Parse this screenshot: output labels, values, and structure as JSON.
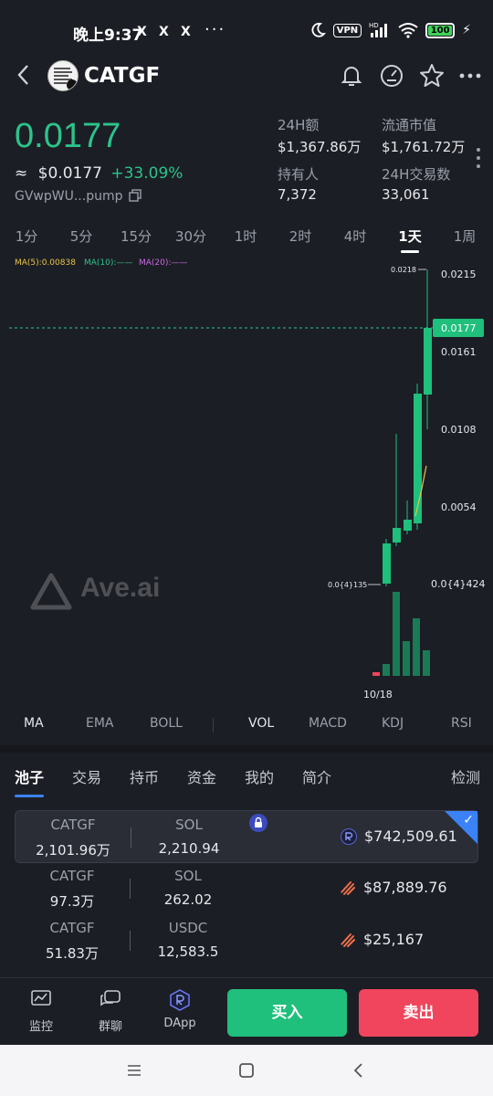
{
  "status": {
    "time": "晚上9:37",
    "x_icons": [
      "X",
      "X",
      "X"
    ],
    "more": "···",
    "vpn": "VPN",
    "hd": "HD",
    "battery": "100"
  },
  "header": {
    "symbol": "CATGF"
  },
  "price": {
    "main": "0.0177",
    "approx": "≈",
    "usd": "$0.0177",
    "change": "+33.09%",
    "address": "GVwpWU...pump"
  },
  "stats": [
    {
      "label": "24H额",
      "value": "$1,367.86万"
    },
    {
      "label": "流通市值",
      "value": "$1,761.72万"
    },
    {
      "label": "持有人",
      "value": "7,372"
    },
    {
      "label": "24H交易数",
      "value": "33,061"
    }
  ],
  "intervals": [
    "1分",
    "5分",
    "15分",
    "30分",
    "1时",
    "2时",
    "4时",
    "1天",
    "1周"
  ],
  "active_interval": "1天",
  "chart": {
    "ma5": "MA(5):0.00838",
    "ma10": "MA(10):——",
    "ma20": "MA(20):——",
    "watermark": "Ave.ai",
    "price_labels": [
      "0.0215",
      "0.0161",
      "0.0108",
      "0.0054"
    ],
    "high_label": "0.0218",
    "low_label": "0.0{4}135",
    "current_label": "0.0177",
    "low_right_label": "0.0{4}424",
    "date_label": "10/18",
    "colors": {
      "up": "#1fbf7c",
      "down": "#f0455c",
      "ma5": "#e8c547",
      "ma10": "#2bc48a",
      "ma20": "#c86be0"
    }
  },
  "indicators": [
    "MA",
    "EMA",
    "BOLL",
    "VOL",
    "MACD",
    "KDJ",
    "RSI"
  ],
  "section_tabs": [
    "池子",
    "交易",
    "持币",
    "资金",
    "我的",
    "简介"
  ],
  "section_right": "检测",
  "pools": [
    {
      "tokenA": "CATGF",
      "amountA": "2,101.96万",
      "tokenB": "SOL",
      "amountB": "2,210.94",
      "liquidity": "$742,509.61",
      "dex_icon": "raydium-icon",
      "selected": true
    },
    {
      "tokenA": "CATGF",
      "amountA": "97.3万",
      "tokenB": "SOL",
      "amountB": "262.02",
      "liquidity": "$87,889.76",
      "dex_icon": "meteora-icon",
      "selected": false
    },
    {
      "tokenA": "CATGF",
      "amountA": "51.83万",
      "tokenB": "USDC",
      "amountB": "12,583.5",
      "liquidity": "$25,167",
      "dex_icon": "meteora-icon",
      "selected": false
    }
  ],
  "bottom_nav": [
    {
      "label": "监控",
      "icon": "monitor-icon"
    },
    {
      "label": "群聊",
      "icon": "chat-icon"
    },
    {
      "label": "DApp",
      "icon": "dapp-icon"
    }
  ],
  "buy_label": "买入",
  "sell_label": "卖出"
}
